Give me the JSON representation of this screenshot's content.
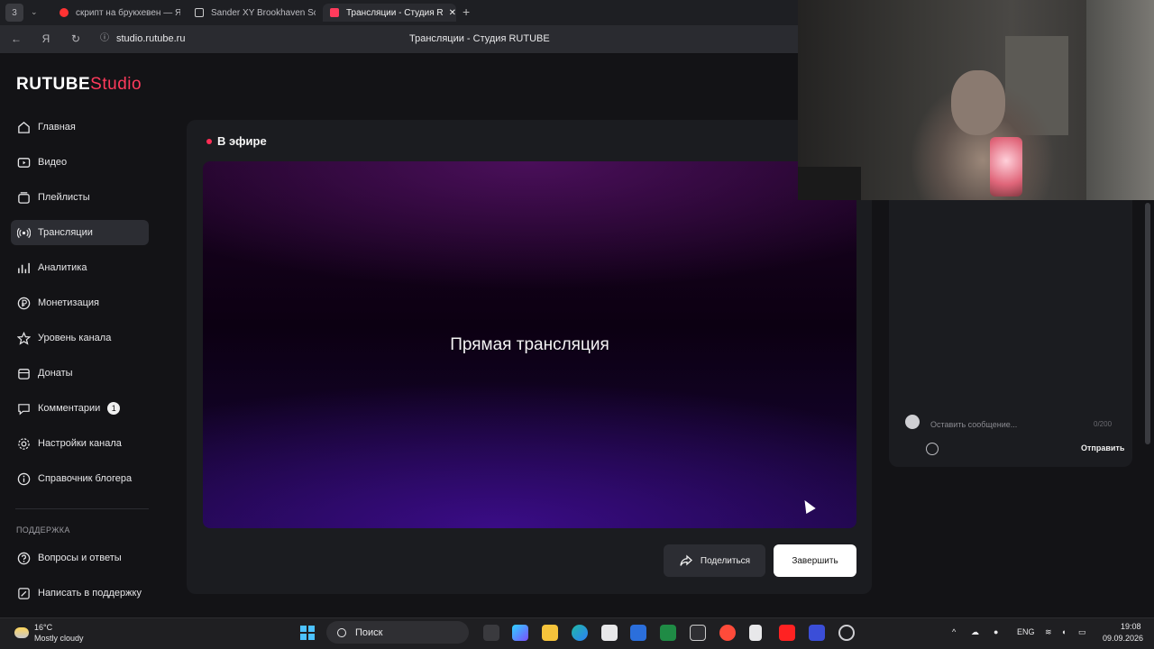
{
  "browser": {
    "tab_count": "3",
    "tabs": [
      {
        "label": "скрипт на брукхевен — Я",
        "color": "#ff3333"
      },
      {
        "label": "Sander XY Brookhaven Sc",
        "color": "#d0d0d0"
      },
      {
        "label": "Трансляции - Студия R",
        "color": "#ff3b5c"
      }
    ],
    "address": "studio.rutube.ru",
    "page_title": "Трансляции - Студия RUTUBE"
  },
  "logo": {
    "brand": "RUTUBE",
    "product": "Studio"
  },
  "sidebar": {
    "items": [
      {
        "label": "Главная",
        "icon": "home-icon"
      },
      {
        "label": "Видео",
        "icon": "video-icon"
      },
      {
        "label": "Плейлисты",
        "icon": "playlist-icon"
      },
      {
        "label": "Трансляции",
        "icon": "broadcast-icon",
        "active": true
      },
      {
        "label": "Аналитика",
        "icon": "analytics-icon"
      },
      {
        "label": "Монетизация",
        "icon": "ruble-icon"
      },
      {
        "label": "Уровень канала",
        "icon": "star-icon"
      },
      {
        "label": "Донаты",
        "icon": "donate-icon"
      },
      {
        "label": "Комментарии",
        "icon": "comment-icon",
        "badge": "1"
      },
      {
        "label": "Настройки канала",
        "icon": "settings-icon"
      },
      {
        "label": "Справочник блогера",
        "icon": "info-icon"
      }
    ],
    "support_heading": "ПОДДЕРЖКА",
    "support_items": [
      {
        "label": "Вопросы и ответы",
        "icon": "question-icon"
      },
      {
        "label": "Написать в поддержку",
        "icon": "edit-icon"
      }
    ]
  },
  "stream": {
    "status": "В эфире",
    "placeholder": "Прямая трансляция",
    "share_label": "Поделиться",
    "finish_label": "Завершить"
  },
  "chat": {
    "input_placeholder": "Оставить сообщение...",
    "counter": "0/200",
    "send_label": "Отправить"
  },
  "taskbar": {
    "temperature": "16°C",
    "weather": "Mostly cloudy",
    "search_label": "Поиск",
    "language": "ENG",
    "time": "19:08",
    "date": "09.09.2026"
  },
  "colors": {
    "accent": "#ff3b5c",
    "live": "#ff2d55",
    "panel": "#1b1c20"
  }
}
